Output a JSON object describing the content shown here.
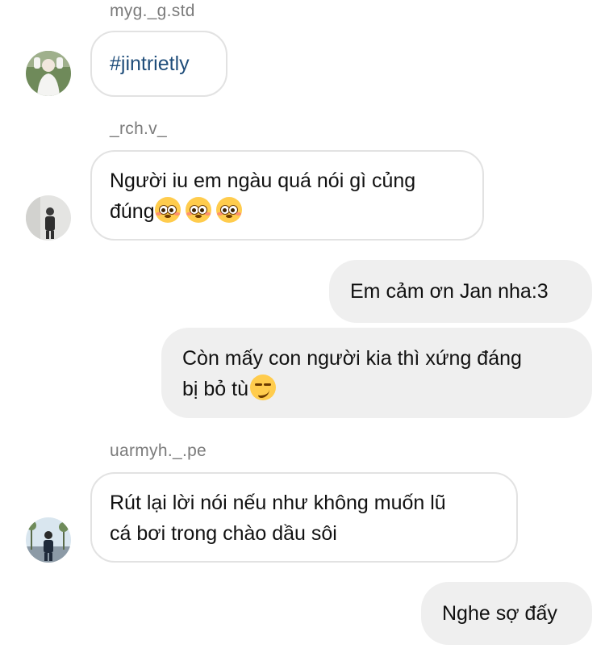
{
  "messages": [
    {
      "sender": "myg._g.std",
      "text": "#jintrietly"
    },
    {
      "sender": "_rch.v_",
      "text_line1": "Người iu em ngàu quá nói gì củng",
      "text_line2": "đúng"
    },
    {
      "outgoing1": "Em cảm ơn Jan nha:3"
    },
    {
      "outgoing2_line1": "Còn mấy con người kia thì xứng đáng",
      "outgoing2_line2": "bị bỏ tù"
    },
    {
      "sender": "uarmyh._.pe",
      "text_line1": "Rút lại lời nói nếu như không muốn lũ",
      "text_line2": "cá bơi trong chào dầu sôi"
    },
    {
      "outgoing3": "Nghe sợ đấy"
    }
  ],
  "icons": {
    "flushed": "flushed-face-emoji",
    "smirk": "smirking-face-emoji"
  },
  "colors": {
    "outgoing_bubble": "#efefef",
    "incoming_border": "#e2e2e2",
    "hashtag": "#1f4d7a",
    "sender_text": "#7b7b7b"
  }
}
